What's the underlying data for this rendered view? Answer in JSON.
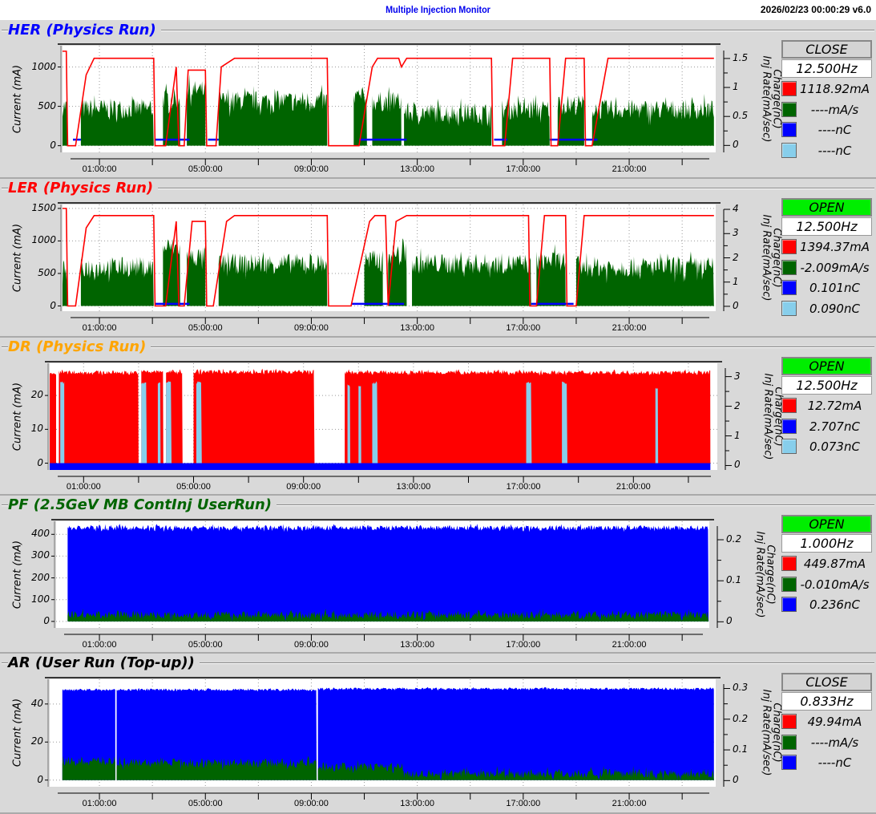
{
  "header": {
    "title": "Multiple Injection Monitor",
    "timestamp": "2026/02/23 00:00:29   v6.0"
  },
  "chart_data": [
    {
      "type": "area",
      "name": "her",
      "title": "HER  (Physics Run)",
      "title_color": "#0000ff",
      "status": "CLOSE",
      "status_color": "#d4d4d4",
      "freq": "12.500Hz",
      "legend": [
        {
          "color": "#ff0000",
          "value": "1118.92mA"
        },
        {
          "color": "#006400",
          "value": "----mA/s"
        },
        {
          "color": "#0000ff",
          "value": "----nC"
        },
        {
          "color": "#87ceeb",
          "value": "----nC"
        }
      ],
      "ylabel": "Current (mA)",
      "y2label": [
        "Charge(nC)",
        "Inj Rate(mA/sec)"
      ],
      "ylim": [
        -85,
        1270
      ],
      "y2lim": [
        -0.12,
        1.72
      ],
      "yticks": [
        0,
        500,
        1000
      ],
      "y2ticks": [
        0,
        0.5,
        1,
        1.5
      ],
      "xticks": [
        "01:00:00",
        "05:00:00",
        "09:00:00",
        "13:00:00",
        "17:00:00",
        "21:00:00"
      ],
      "xtick_hours": [
        1,
        5,
        9,
        13,
        17,
        21
      ],
      "xlim_hours": [
        -0.4,
        24.2
      ],
      "series": [
        {
          "name": "inj-rate",
          "type": "area",
          "color": "#006400",
          "noise": 130,
          "on": [
            [
              -0.4,
              -0.2,
              500
            ],
            [
              0.3,
              3.05,
              470
            ],
            [
              3.4,
              4.05,
              600
            ],
            [
              4.3,
              5.0,
              700
            ],
            [
              5.5,
              9.6,
              570
            ],
            [
              10.6,
              11.1,
              620
            ],
            [
              11.3,
              12.4,
              560
            ],
            [
              12.5,
              15.8,
              420
            ],
            [
              16.2,
              18.0,
              460
            ],
            [
              18.3,
              19.3,
              520
            ],
            [
              19.6,
              24.2,
              460
            ]
          ]
        },
        {
          "name": "charge-blue",
          "type": "line",
          "color": "#0000ff",
          "axis": "right",
          "points": [
            [
              0.0,
              0.1
            ],
            [
              0.3,
              0.1
            ],
            [
              null,
              null
            ],
            [
              3.1,
              0.1
            ],
            [
              4.4,
              0.1
            ],
            [
              null,
              null
            ],
            [
              5.1,
              0.1
            ],
            [
              5.5,
              0.1
            ],
            [
              null,
              null
            ],
            [
              10.8,
              0.1
            ],
            [
              12.6,
              0.1
            ],
            [
              null,
              null
            ],
            [
              15.9,
              0.1
            ],
            [
              16.4,
              0.1
            ],
            [
              null,
              null
            ],
            [
              18.0,
              0.1
            ],
            [
              19.8,
              0.1
            ]
          ]
        },
        {
          "name": "current",
          "type": "line",
          "color": "#ff0000",
          "points": [
            [
              -0.4,
              1200
            ],
            [
              -0.25,
              1200
            ],
            [
              -0.2,
              0
            ],
            [
              0.1,
              0
            ],
            [
              0.5,
              900
            ],
            [
              0.8,
              1110
            ],
            [
              3.05,
              1110
            ],
            [
              3.1,
              0
            ],
            [
              3.5,
              0
            ],
            [
              3.9,
              1000
            ],
            [
              4.0,
              0
            ],
            [
              4.2,
              0
            ],
            [
              4.35,
              960
            ],
            [
              5.0,
              960
            ],
            [
              5.05,
              0
            ],
            [
              5.4,
              0
            ],
            [
              5.6,
              1000
            ],
            [
              6.1,
              1110
            ],
            [
              9.6,
              1110
            ],
            [
              9.65,
              0
            ],
            [
              10.8,
              0
            ],
            [
              11.3,
              1000
            ],
            [
              11.5,
              1110
            ],
            [
              12.3,
              1110
            ],
            [
              12.4,
              1000
            ],
            [
              12.6,
              1110
            ],
            [
              15.8,
              1110
            ],
            [
              15.85,
              0
            ],
            [
              16.3,
              0
            ],
            [
              16.6,
              1110
            ],
            [
              18.0,
              1110
            ],
            [
              18.05,
              0
            ],
            [
              18.3,
              0
            ],
            [
              18.6,
              1110
            ],
            [
              19.3,
              1110
            ],
            [
              19.35,
              0
            ],
            [
              19.6,
              0
            ],
            [
              20.2,
              1110
            ],
            [
              24.2,
              1110
            ]
          ]
        }
      ]
    },
    {
      "type": "area",
      "name": "ler",
      "title": "LER  (Physics Run)",
      "title_color": "#ff0000",
      "status": "OPEN",
      "status_color": "#00ee00",
      "freq": "12.500Hz",
      "legend": [
        {
          "color": "#ff0000",
          "value": "1394.37mA"
        },
        {
          "color": "#006400",
          "value": "-2.009mA/s"
        },
        {
          "color": "#0000ff",
          "value": "0.101nC"
        },
        {
          "color": "#87ceeb",
          "value": "0.090nC"
        }
      ],
      "ylabel": "Current (mA)",
      "y2label": [
        "Charge(nC)",
        "Inj Rate(mA/sec)"
      ],
      "ylim": [
        -80,
        1560
      ],
      "y2lim": [
        -0.2,
        4.2
      ],
      "yticks": [
        0,
        500,
        1000,
        1500
      ],
      "y2ticks": [
        0,
        1,
        2,
        3,
        4
      ],
      "xticks": [
        "01:00:00",
        "05:00:00",
        "09:00:00",
        "13:00:00",
        "17:00:00",
        "21:00:00"
      ],
      "xtick_hours": [
        1,
        5,
        9,
        13,
        17,
        21
      ],
      "xlim_hours": [
        -0.4,
        24.2
      ],
      "series": [
        {
          "name": "inj-rate",
          "type": "area",
          "color": "#006400",
          "noise": 160,
          "on": [
            [
              -0.4,
              -0.2,
              550
            ],
            [
              0.3,
              3.05,
              600
            ],
            [
              3.4,
              4.05,
              900
            ],
            [
              4.3,
              5.0,
              750
            ],
            [
              5.5,
              9.6,
              650
            ],
            [
              11.0,
              11.7,
              700
            ],
            [
              11.9,
              12.6,
              800
            ],
            [
              12.8,
              17.3,
              650
            ],
            [
              17.5,
              18.6,
              700
            ],
            [
              19.0,
              24.2,
              600
            ]
          ]
        },
        {
          "name": "charge-blue",
          "type": "line",
          "color": "#0000ff",
          "axis": "right",
          "points": [
            [
              10.5,
              0.1
            ],
            [
              12.5,
              0.1
            ],
            [
              null,
              null
            ],
            [
              3.1,
              0.1
            ],
            [
              4.4,
              0.1
            ],
            [
              null,
              null
            ],
            [
              17.3,
              0.1
            ],
            [
              18.9,
              0.1
            ]
          ]
        },
        {
          "name": "current",
          "type": "line",
          "color": "#ff0000",
          "points": [
            [
              -0.4,
              1500
            ],
            [
              -0.25,
              1500
            ],
            [
              -0.2,
              0
            ],
            [
              0.1,
              0
            ],
            [
              0.5,
              1200
            ],
            [
              0.8,
              1390
            ],
            [
              3.05,
              1390
            ],
            [
              3.1,
              0
            ],
            [
              3.5,
              0
            ],
            [
              3.9,
              1300
            ],
            [
              4.0,
              0
            ],
            [
              4.2,
              0
            ],
            [
              4.5,
              1300
            ],
            [
              5.0,
              1300
            ],
            [
              5.05,
              0
            ],
            [
              5.3,
              0
            ],
            [
              5.8,
              1300
            ],
            [
              6.1,
              1390
            ],
            [
              9.6,
              1390
            ],
            [
              9.65,
              0
            ],
            [
              10.5,
              0
            ],
            [
              11.2,
              1300
            ],
            [
              11.4,
              1390
            ],
            [
              11.8,
              1390
            ],
            [
              11.9,
              0
            ],
            [
              12.2,
              1300
            ],
            [
              12.6,
              1390
            ],
            [
              17.2,
              1390
            ],
            [
              17.25,
              0
            ],
            [
              17.5,
              0
            ],
            [
              17.8,
              1390
            ],
            [
              18.6,
              1390
            ],
            [
              18.65,
              0
            ],
            [
              19.0,
              0
            ],
            [
              19.3,
              1390
            ],
            [
              24.2,
              1390
            ]
          ]
        }
      ]
    },
    {
      "type": "area",
      "name": "dr",
      "title": "DR  (Physics Run)",
      "title_color": "#ffa500",
      "status": "OPEN",
      "status_color": "#00ee00",
      "freq": "12.500Hz",
      "legend": [
        {
          "color": "#ff0000",
          "value": "12.72mA"
        },
        {
          "color": "#0000ff",
          "value": "2.707nC"
        },
        {
          "color": "#87ceeb",
          "value": "0.073nC"
        }
      ],
      "ylabel": "Current (mA)",
      "y2label": [
        "Charge(nC)",
        "Inj Rate(mA/sec)"
      ],
      "ylim": [
        -2,
        29.5
      ],
      "y2lim": [
        -0.15,
        3.45
      ],
      "yticks": [
        0,
        10,
        20
      ],
      "y2ticks": [
        0,
        1,
        2,
        3
      ],
      "xticks": [
        "01:00:00",
        "05:00:00",
        "09:00:00",
        "13:00:00",
        "17:00:00",
        "21:00:00"
      ],
      "xtick_hours": [
        1,
        5,
        9,
        13,
        17,
        21
      ],
      "xlim_hours": [
        -0.25,
        23.8
      ],
      "series": [
        {
          "name": "current",
          "type": "area",
          "color": "#ff0000",
          "noise": 0.6,
          "on": [
            [
              -0.25,
              0.0,
              26.5
            ],
            [
              0.1,
              3.0,
              26.8
            ],
            [
              3.1,
              3.9,
              27
            ],
            [
              4.0,
              4.6,
              27
            ],
            [
              5.0,
              9.4,
              27
            ],
            [
              10.5,
              23.8,
              26.8
            ]
          ]
        },
        {
          "name": "charge-lightblue",
          "type": "area",
          "color": "#87ceeb",
          "axis": "right",
          "noise": 0.05,
          "on": [
            [
              0.15,
              0.3,
              2.8
            ],
            [
              3.1,
              3.3,
              2.8
            ],
            [
              3.7,
              3.8,
              2.8
            ],
            [
              4.0,
              4.2,
              2.8
            ],
            [
              5.1,
              5.3,
              2.8
            ],
            [
              10.6,
              10.7,
              2.7
            ],
            [
              11.0,
              11.1,
              2.7
            ],
            [
              11.5,
              11.7,
              2.8
            ],
            [
              17.1,
              17.3,
              2.8
            ],
            [
              18.4,
              18.6,
              2.8
            ],
            [
              21.8,
              21.9,
              2.6
            ]
          ]
        },
        {
          "name": "charge-blue",
          "type": "area",
          "color": "#0000ff",
          "noise": 0,
          "on": [
            [
              -0.25,
              23.8,
              -1.9
            ]
          ]
        }
      ]
    },
    {
      "type": "area",
      "name": "pf",
      "title": "PF  (2.5GeV MB ContInj UserRun)",
      "title_color": "#006400",
      "status": "OPEN",
      "status_color": "#00ee00",
      "freq": "1.000Hz",
      "legend": [
        {
          "color": "#ff0000",
          "value": "449.87mA"
        },
        {
          "color": "#006400",
          "value": "-0.010mA/s"
        },
        {
          "color": "#0000ff",
          "value": "0.236nC"
        }
      ],
      "ylabel": "Current (mA)",
      "y2label": [
        "Charge(nC)",
        "Inj Rate(mA/sec)"
      ],
      "ylim": [
        -30,
        460
      ],
      "y2lim": [
        -0.015,
        0.245
      ],
      "yticks": [
        0,
        100,
        200,
        300,
        400
      ],
      "y2ticks": [
        0,
        0.1,
        0.2
      ],
      "xticks": [
        "01:00:00",
        "05:00:00",
        "09:00:00",
        "13:00:00",
        "17:00:00",
        "21:00:00"
      ],
      "xtick_hours": [
        1,
        5,
        9,
        13,
        17,
        21
      ],
      "xlim_hours": [
        -0.2,
        24.2
      ],
      "series": [
        {
          "name": "charge-blue",
          "type": "area",
          "color": "#0000ff",
          "noise": 12,
          "on": [
            [
              -0.2,
              24.0,
              430
            ]
          ]
        },
        {
          "name": "inj-rate",
          "type": "area",
          "color": "#006400",
          "noise": 18,
          "on": [
            [
              -0.2,
              24.0,
              30
            ]
          ]
        }
      ]
    },
    {
      "type": "area",
      "name": "ar",
      "title": "AR  (User Run (Top-up))",
      "title_color": "#000000",
      "status": "CLOSE",
      "status_color": "#d4d4d4",
      "freq": "0.833Hz",
      "legend": [
        {
          "color": "#ff0000",
          "value": "49.94mA"
        },
        {
          "color": "#006400",
          "value": "----mA/s"
        },
        {
          "color": "#0000ff",
          "value": "----nC"
        }
      ],
      "ylabel": "Current (mA)",
      "y2label": [
        "Charge(nC)",
        "Inj Rate(mA/sec)"
      ],
      "ylim": [
        -3.5,
        53
      ],
      "y2lim": [
        -0.02,
        0.33
      ],
      "yticks": [
        0,
        20,
        40
      ],
      "y2ticks": [
        0,
        0.1,
        0.2,
        0.3
      ],
      "xticks": [
        "01:00:00",
        "05:00:00",
        "09:00:00",
        "13:00:00",
        "17:00:00",
        "21:00:00"
      ],
      "xtick_hours": [
        1,
        5,
        9,
        13,
        17,
        21
      ],
      "xlim_hours": [
        -0.4,
        24.2
      ],
      "series": [
        {
          "name": "charge-blue",
          "type": "area",
          "color": "#0000ff",
          "noise": 0.6,
          "on": [
            [
              -0.4,
              1.6,
              47.5
            ],
            [
              1.65,
              9.2,
              47.5
            ],
            [
              9.25,
              24.2,
              48
            ]
          ]
        },
        {
          "name": "inj-rate",
          "type": "area",
          "color": "#006400",
          "noise": 2.5,
          "on": [
            [
              -0.4,
              1.6,
              10
            ],
            [
              1.65,
              9.2,
              9
            ],
            [
              9.25,
              12.5,
              7
            ],
            [
              12.5,
              24.2,
              3.5
            ]
          ]
        }
      ]
    }
  ]
}
